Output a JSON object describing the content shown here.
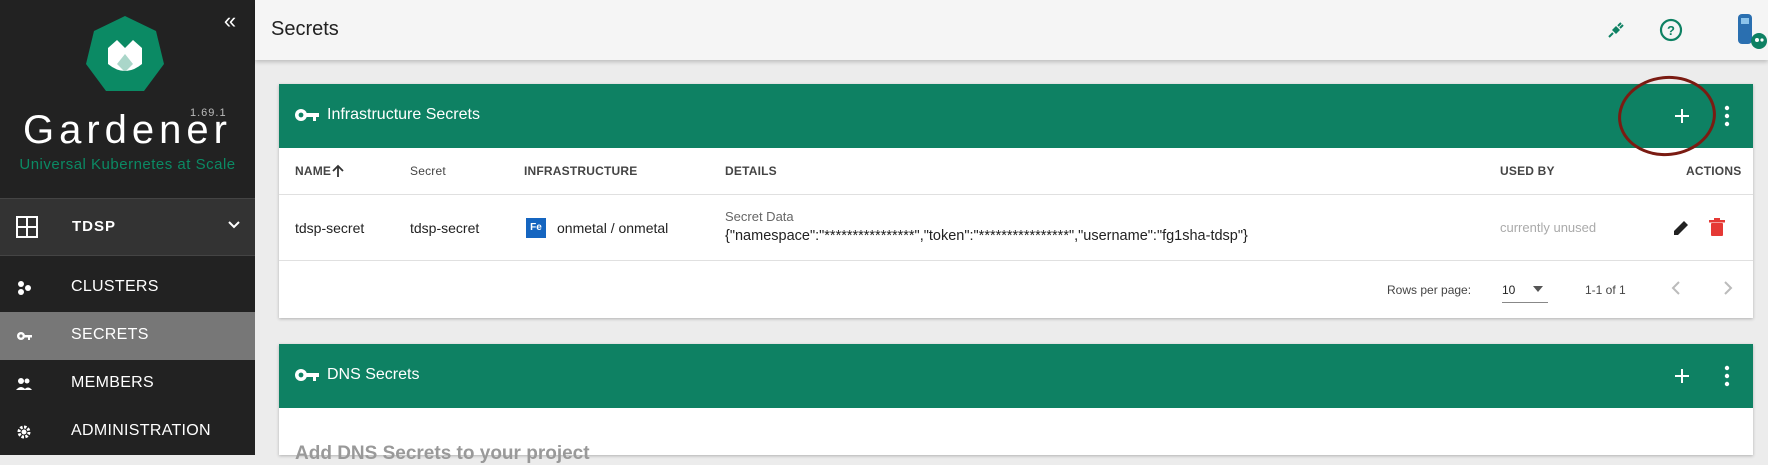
{
  "app": {
    "brand": "Gardener",
    "version": "1.69.1",
    "tagline": "Universal Kubernetes at Scale",
    "accent_color": "#0e8163"
  },
  "project": {
    "name": "TDSP"
  },
  "nav": [
    {
      "label": "CLUSTERS",
      "icon": "clusters-icon",
      "active": false
    },
    {
      "label": "SECRETS",
      "icon": "key-icon",
      "active": true
    },
    {
      "label": "MEMBERS",
      "icon": "members-icon",
      "active": false
    },
    {
      "label": "ADMINISTRATION",
      "icon": "gear-icon",
      "active": false
    }
  ],
  "topbar": {
    "title": "Secrets"
  },
  "infra_card": {
    "title": "Infrastructure Secrets",
    "columns": [
      "NAME",
      "Secret",
      "INFRASTRUCTURE",
      "DETAILS",
      "USED BY",
      "ACTIONS"
    ],
    "rows": [
      {
        "name": "tdsp-secret",
        "secret": "tdsp-secret",
        "infra_badge": "Fe",
        "infrastructure": "onmetal / onmetal",
        "details_label": "Secret Data",
        "details_value": "{\"namespace\":\"****************\",\"token\":\"****************\",\"username\":\"fg1sha-tdsp\"}",
        "used_by": "currently unused"
      }
    ],
    "pagination": {
      "rows_per_page_label": "Rows per page:",
      "rows_per_page": "10",
      "range": "1-1 of 1"
    }
  },
  "dns_card": {
    "title": "DNS Secrets",
    "empty_text": "Add DNS Secrets to your project"
  }
}
